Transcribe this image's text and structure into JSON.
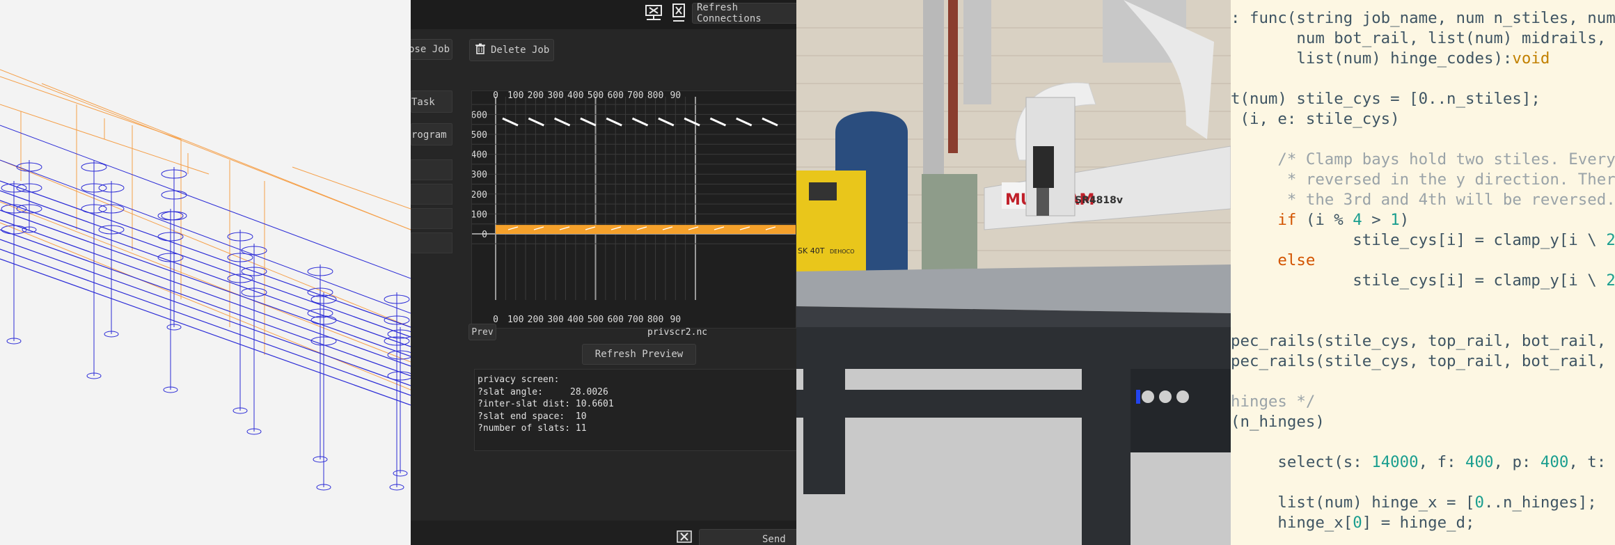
{
  "cnc_ui": {
    "toolbar": {
      "refresh_connections_label": "Refresh Connections"
    },
    "job_buttons": {
      "close_job_label": "ose Job",
      "delete_job_label": "Delete Job"
    },
    "task_buttons": [
      {
        "label": "Task"
      },
      {
        "label": "rogram"
      }
    ],
    "preview": {
      "prev_label": "Prev",
      "filename": "privscr2.nc",
      "refresh_preview_label": "Refresh Preview",
      "x_ticks": [
        "0",
        "100",
        "200",
        "300",
        "400",
        "500",
        "600",
        "700",
        "800",
        "90"
      ],
      "y_ticks": [
        "600",
        "500",
        "400",
        "300",
        "200",
        "100",
        "0"
      ]
    },
    "info_lines": [
      {
        "text": "privacy screen:"
      },
      {
        "text": "?slat angle:     28.0026"
      },
      {
        "text": "?inter-slat dist: 10.6601"
      },
      {
        "text": "?slat end space:  10"
      },
      {
        "text": "?number of slats: 11"
      }
    ],
    "send_label": "Send",
    "icons": {
      "network": "network-monitor-icon",
      "close": "close-icon",
      "trash": "trash-icon",
      "cancel": "cancel-icon"
    }
  },
  "photo": {
    "brand_label": "MULTICAM",
    "model_label": "SR4818v",
    "compressor_label": "SK 40T",
    "compressor_brand": "DEHOCO"
  },
  "code": {
    "lines": [
      [
        {
          "t": ": func(string job_name, num n_stiles, num",
          "c": ""
        }
      ],
      [
        {
          "t": "       num bot_rail, list(num) midrails,",
          "c": ""
        }
      ],
      [
        {
          "t": "       list(num) hinge_codes):",
          "c": ""
        },
        {
          "t": "void",
          "c": "ty"
        }
      ],
      [
        {
          "t": "",
          "c": ""
        }
      ],
      [
        {
          "t": "t(num) stile_cys = [0..n_stiles];",
          "c": ""
        }
      ],
      [
        {
          "t": " (i, e: stile_cys)",
          "c": ""
        }
      ],
      [
        {
          "t": "",
          "c": ""
        }
      ],
      [
        {
          "t": "     /* Clamp bays hold two stiles. Every",
          "c": "cm"
        }
      ],
      [
        {
          "t": "      * reversed in the y direction. Ther",
          "c": "cm"
        }
      ],
      [
        {
          "t": "      * the 3rd and 4th will be reversed.",
          "c": "cm"
        }
      ],
      [
        {
          "t": "     ",
          "c": ""
        },
        {
          "t": "if",
          "c": "kw"
        },
        {
          "t": " (i % ",
          "c": ""
        },
        {
          "t": "4",
          "c": "num"
        },
        {
          "t": " > ",
          "c": ""
        },
        {
          "t": "1",
          "c": "num"
        },
        {
          "t": ")",
          "c": ""
        }
      ],
      [
        {
          "t": "             stile_cys[i] = clamp_y[i \\ ",
          "c": ""
        },
        {
          "t": "2",
          "c": "num"
        }
      ],
      [
        {
          "t": "     ",
          "c": ""
        },
        {
          "t": "else",
          "c": "kw"
        }
      ],
      [
        {
          "t": "             stile_cys[i] = clamp_y[i \\ ",
          "c": ""
        },
        {
          "t": "2",
          "c": "num"
        }
      ],
      [
        {
          "t": "",
          "c": ""
        }
      ],
      [
        {
          "t": "",
          "c": ""
        }
      ],
      [
        {
          "t": "pec_rails(stile_cys, top_rail, bot_rail,",
          "c": ""
        }
      ],
      [
        {
          "t": "pec_rails(stile_cys, top_rail, bot_rail,",
          "c": ""
        }
      ],
      [
        {
          "t": "",
          "c": ""
        }
      ],
      [
        {
          "t": "hinges */",
          "c": "cm"
        }
      ],
      [
        {
          "t": "(n_hinges)",
          "c": ""
        }
      ],
      [
        {
          "t": "",
          "c": ""
        }
      ],
      [
        {
          "t": "     select(s: ",
          "c": ""
        },
        {
          "t": "14000",
          "c": "num"
        },
        {
          "t": ", f: ",
          "c": ""
        },
        {
          "t": "400",
          "c": "num"
        },
        {
          "t": ", p: ",
          "c": ""
        },
        {
          "t": "400",
          "c": "num"
        },
        {
          "t": ", t:",
          "c": ""
        }
      ],
      [
        {
          "t": "",
          "c": ""
        }
      ],
      [
        {
          "t": "     list(num) hinge_x = [",
          "c": ""
        },
        {
          "t": "0",
          "c": "num"
        },
        {
          "t": "..n_hinges];",
          "c": ""
        }
      ],
      [
        {
          "t": "     hinge_x[",
          "c": ""
        },
        {
          "t": "0",
          "c": "num"
        },
        {
          "t": "] = hinge_d;",
          "c": ""
        }
      ]
    ]
  },
  "colors": {
    "wire_blue": "#2b2bd6",
    "wire_orange": "#f5a04a",
    "ui_bg": "#262626",
    "slat_orange": "#f5a12b",
    "code_bg": "#fdf7e3",
    "keyword": "#d35400",
    "number": "#1a9e8f",
    "comment": "#9aa3a8"
  }
}
